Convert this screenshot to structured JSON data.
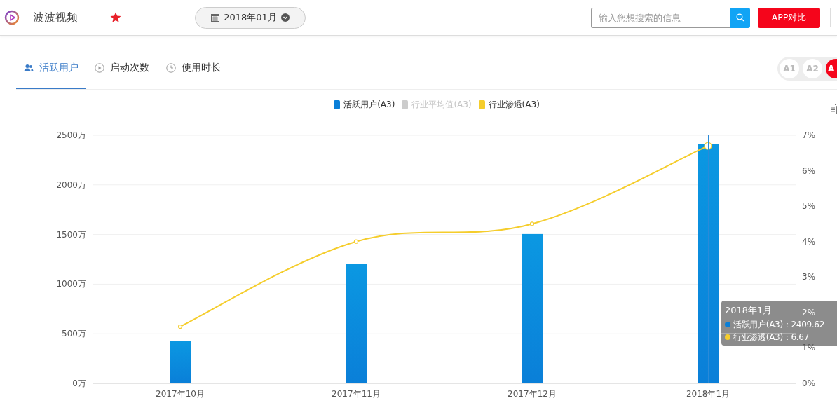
{
  "header": {
    "app_name": "波波视频",
    "favorite": true,
    "date": "2018年01月",
    "search": {
      "placeholder": "输入您想搜索的信息"
    },
    "compare_button": "APP对比"
  },
  "tabs": [
    {
      "label": "活跃用户",
      "selected": true
    },
    {
      "label": "启动次数",
      "selected": false
    },
    {
      "label": "使用时长",
      "selected": false
    }
  ],
  "levels": [
    {
      "label": "A1",
      "selected": false
    },
    {
      "label": "A2",
      "selected": false
    },
    {
      "label": "A",
      "selected": true
    }
  ],
  "legend": [
    {
      "enabled": true
    },
    {
      "enabled": false
    },
    {
      "enabled": true
    }
  ],
  "chart_data": {
    "type": "bar",
    "grid": true,
    "categories": [
      "2017年10月",
      "2017年11月",
      "2017年12月",
      "2018年1月"
    ],
    "series": [
      {
        "name": "活跃用户(A3)",
        "color": "#0a7fd8",
        "values": [
          425,
          1205,
          1505,
          2410
        ]
      },
      {
        "name": "行业平均值(A3)",
        "color": "#cccccc",
        "values": [
          null,
          null,
          null,
          null
        ]
      },
      {
        "name": "行业渗透(A3)",
        "color": "#f5cd2c",
        "values": [
          1.6,
          4.0,
          4.5,
          6.7
        ]
      }
    ],
    "ylim": [
      0,
      2500
    ],
    "yticks": [
      {
        "value": 0,
        "label": "0万"
      },
      {
        "value": 500,
        "label": "500万"
      },
      {
        "value": 1000,
        "label": "1000万"
      },
      {
        "value": 1500,
        "label": "1500万"
      },
      {
        "value": 2000,
        "label": "2000万"
      },
      {
        "value": 2500,
        "label": "2500万"
      }
    ],
    "y2lim": [
      0,
      7
    ],
    "y2ticks": [
      {
        "value": 0,
        "label": "0%"
      },
      {
        "value": 1,
        "label": "1%"
      },
      {
        "value": 2,
        "label": "2%"
      },
      {
        "value": 3,
        "label": "3%"
      },
      {
        "value": 4,
        "label": "4%"
      },
      {
        "value": 5,
        "label": "5%"
      },
      {
        "value": 6,
        "label": "6%"
      },
      {
        "value": 7,
        "label": "7%"
      }
    ]
  },
  "tooltip": {
    "title": "2018年1月",
    "rows": [
      {
        "text": "活跃用户(A3)：2409.62",
        "color": "#0a7fd8"
      },
      {
        "text": "行业渗透(A3)：6.67",
        "color": "#f5cd2c"
      }
    ]
  }
}
